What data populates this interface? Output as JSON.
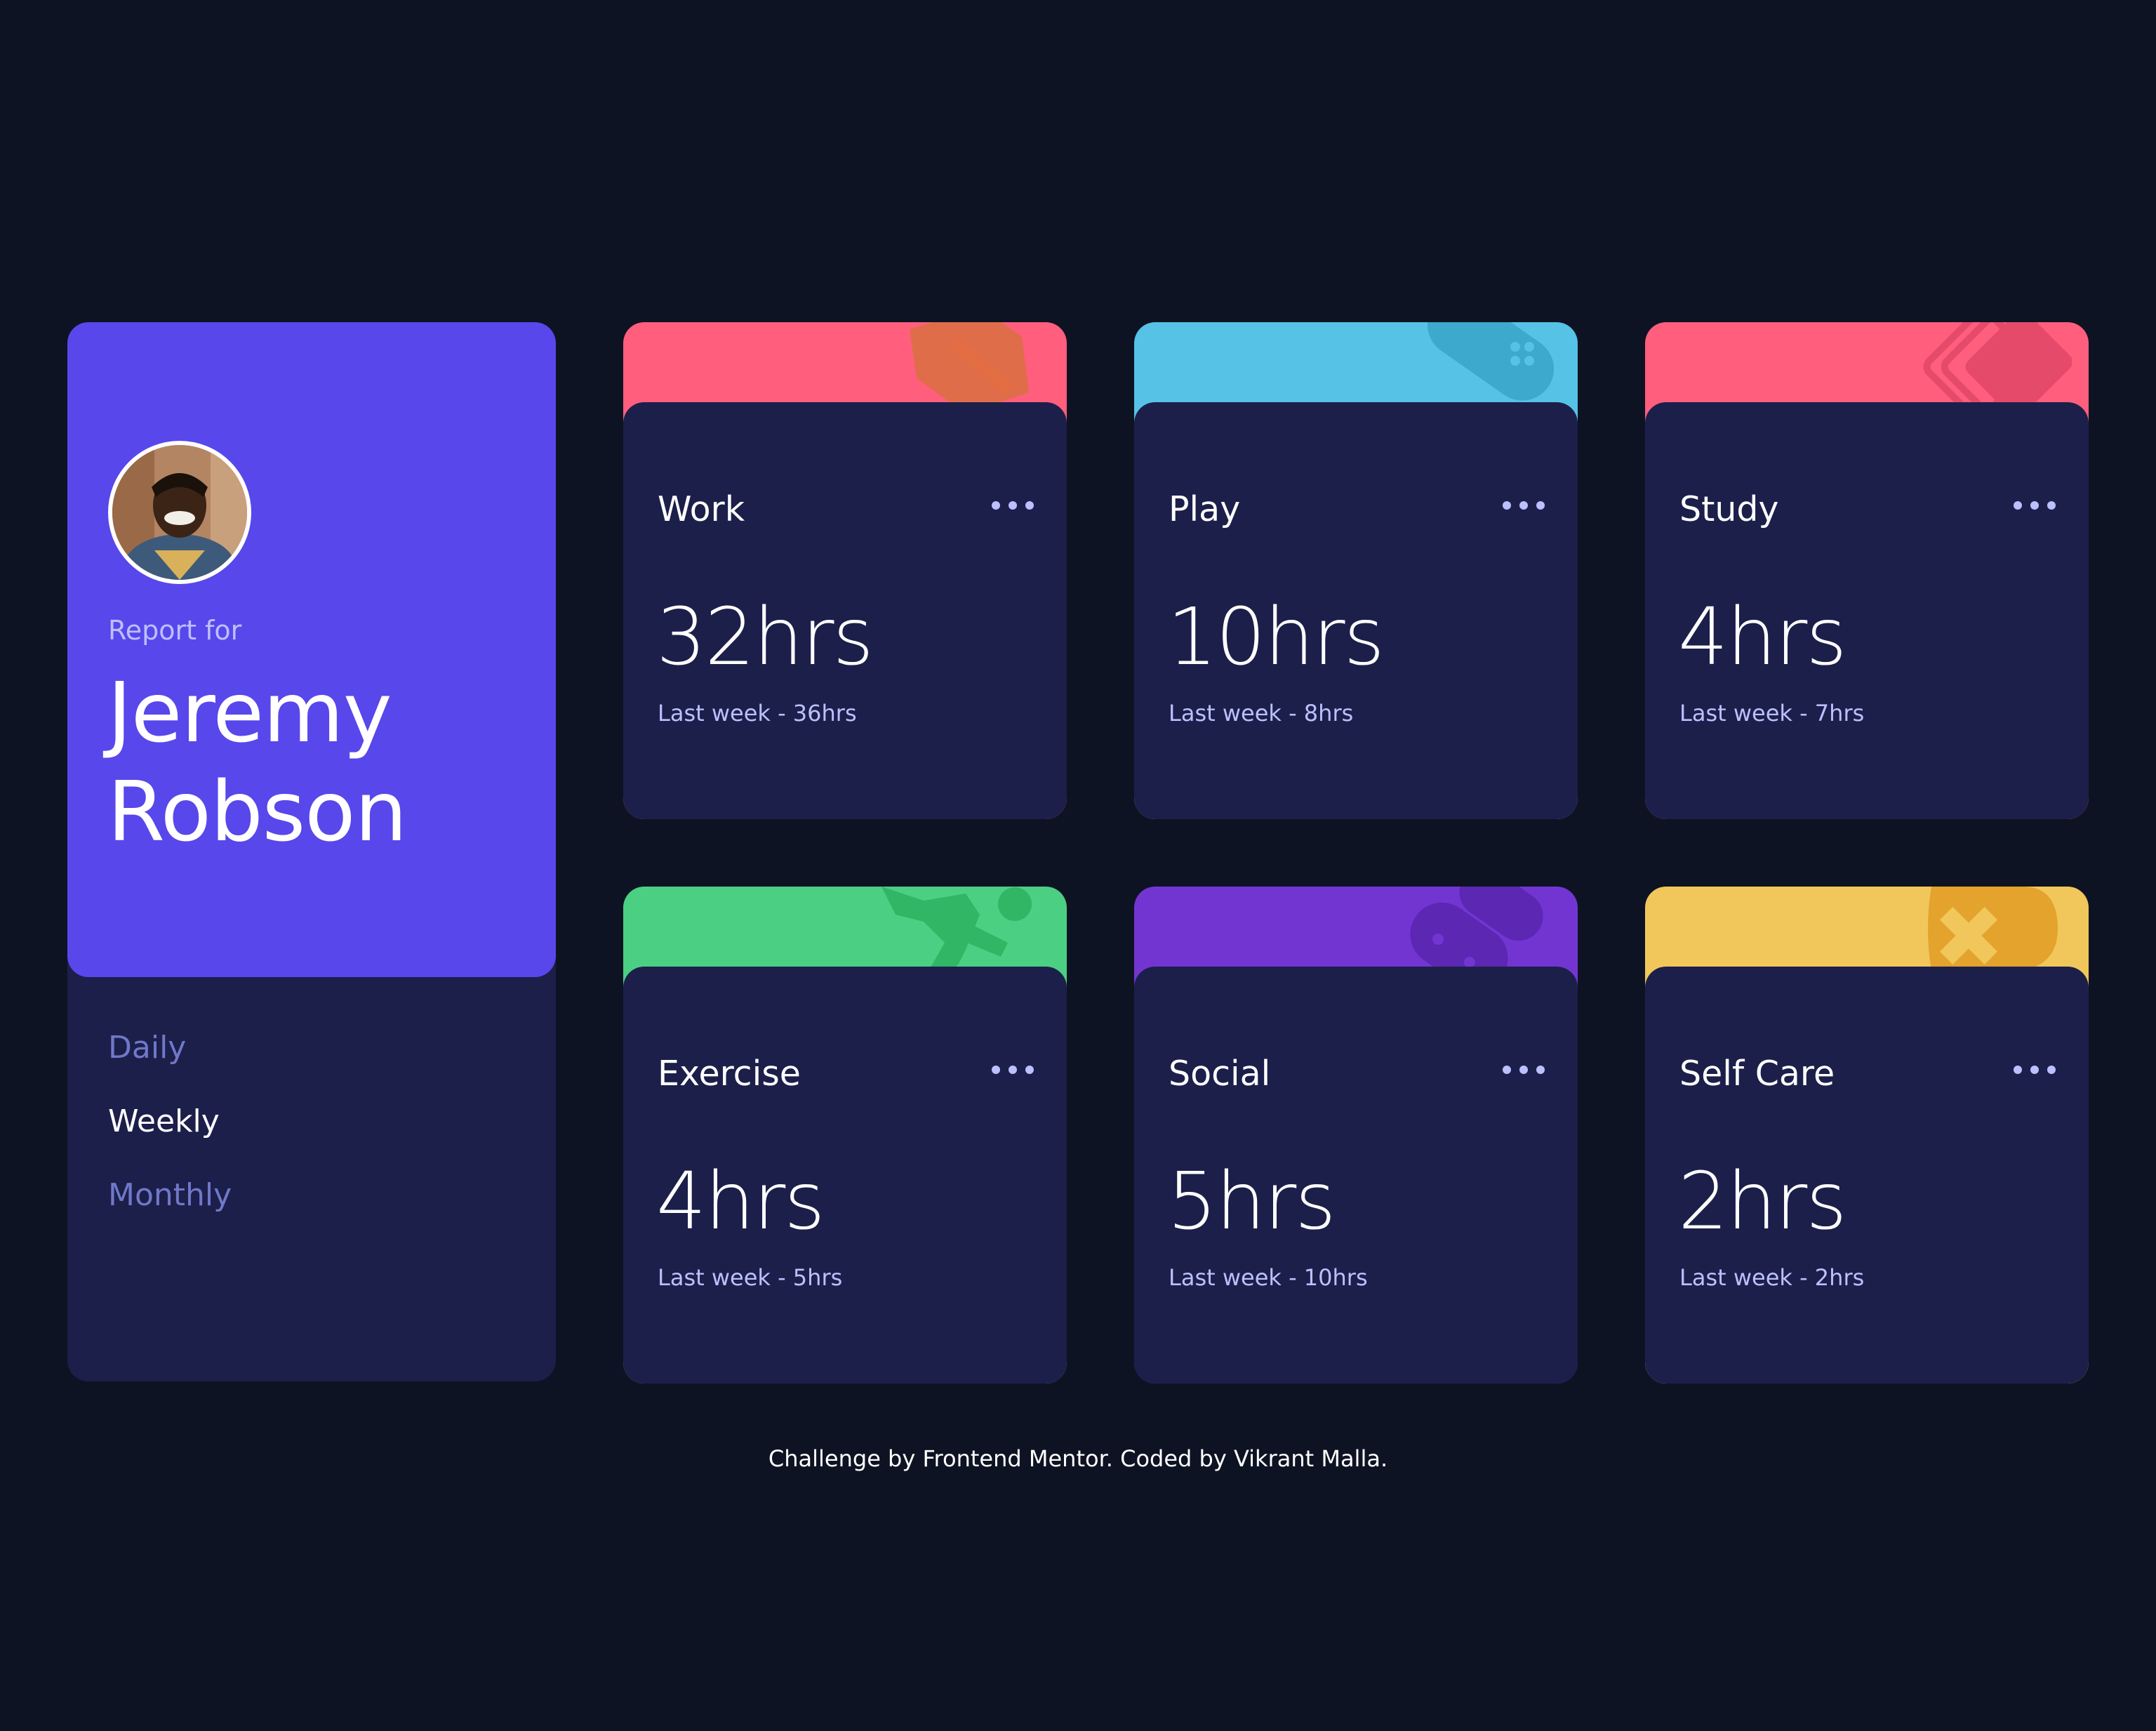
{
  "profile": {
    "report_for": "Report for",
    "name_first": "Jeremy",
    "name_last": "Robson",
    "avatar_icon": "user-portrait",
    "accent_color": "#5847eb"
  },
  "periods": [
    {
      "label": "Daily",
      "active": false
    },
    {
      "label": "Weekly",
      "active": true
    },
    {
      "label": "Monthly",
      "active": false
    }
  ],
  "cards": [
    {
      "title": "Work",
      "hours": "32hrs",
      "previous_label": "Last week",
      "previous_value": "36hrs",
      "color": "#ff5e7d",
      "icon": "briefcase-icon"
    },
    {
      "title": "Play",
      "hours": "10hrs",
      "previous_label": "Last week",
      "previous_value": "8hrs",
      "color": "#55c2e6",
      "icon": "gamepad-icon"
    },
    {
      "title": "Study",
      "hours": "4hrs",
      "previous_label": "Last week",
      "previous_value": "7hrs",
      "color": "#ff5e7d",
      "icon": "book-icon"
    },
    {
      "title": "Exercise",
      "hours": "4hrs",
      "previous_label": "Last week",
      "previous_value": "5hrs",
      "color": "#4bcf82",
      "icon": "running-icon"
    },
    {
      "title": "Social",
      "hours": "5hrs",
      "previous_label": "Last week",
      "previous_value": "10hrs",
      "color": "#7335d2",
      "icon": "chat-icon"
    },
    {
      "title": "Self Care",
      "hours": "2hrs",
      "previous_label": "Last week",
      "previous_value": "2hrs",
      "color": "#f1c75b",
      "icon": "heart-icon"
    }
  ],
  "footer": "Challenge by Frontend Mentor. Coded by Vikrant Malla."
}
